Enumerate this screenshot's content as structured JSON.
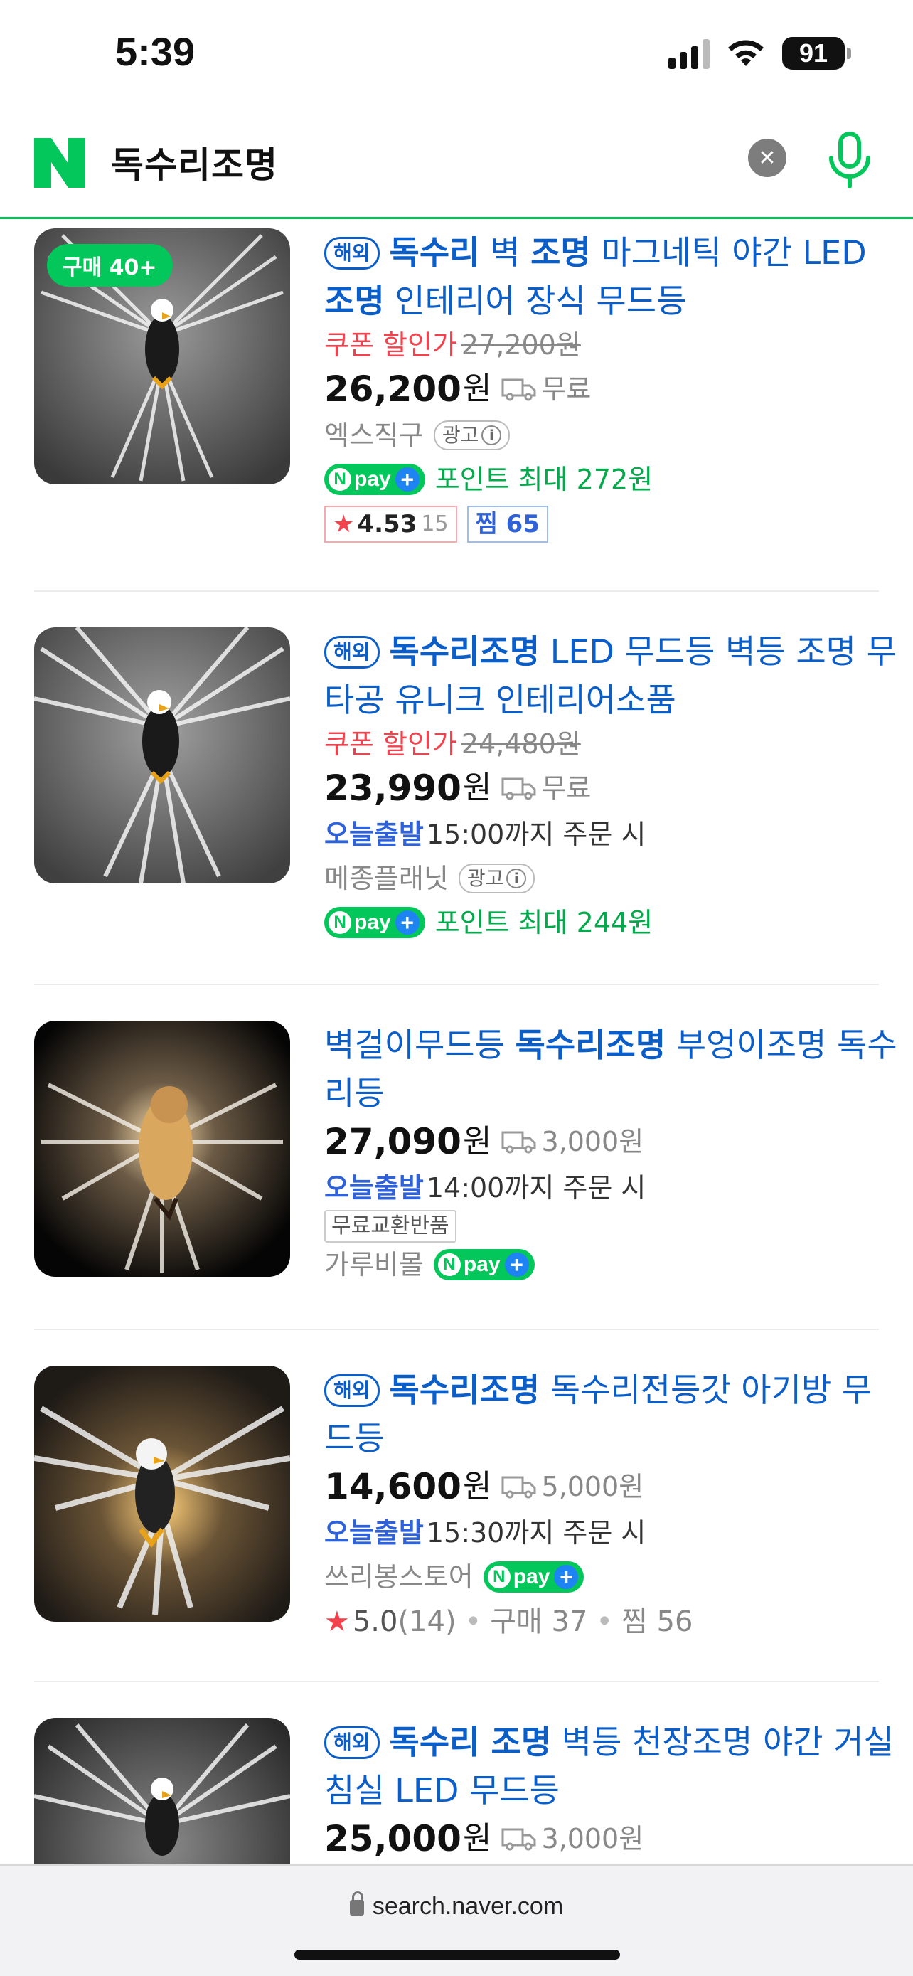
{
  "status_bar": {
    "time": "5:39",
    "battery": "91"
  },
  "search": {
    "query": "독수리조명"
  },
  "products": [
    {
      "buy_badge": "구매 40+",
      "abroad": "해외",
      "title_parts": [
        {
          "t": "독수리",
          "b": true
        },
        {
          "t": " 벽 ",
          "b": false
        },
        {
          "t": "조명",
          "b": true
        },
        {
          "t": " 마그네틱 야간 LED ",
          "b": false
        },
        {
          "t": "조명",
          "b": true
        },
        {
          "t": " 인테리어 장식 무드등",
          "b": false
        }
      ],
      "coupon_label": "쿠폰 할인가",
      "original_price": "27,200원",
      "price": "26,200",
      "won": "원",
      "shipping": "무료",
      "seller": "엑스직구",
      "ad_label": "광고",
      "npay_text": "pay",
      "points": "포인트 최대 272원",
      "rating": "4.53",
      "rating_count": "15",
      "zzim": "찜 65"
    },
    {
      "abroad": "해외",
      "title_parts": [
        {
          "t": "독수리조명",
          "b": true
        },
        {
          "t": " LED 무드등 벽등 조명 무타공 유니크 인테리어소품",
          "b": false
        }
      ],
      "coupon_label": "쿠폰 할인가",
      "original_price": "24,480원",
      "price": "23,990",
      "won": "원",
      "shipping": "무료",
      "today_label": "오늘출발",
      "today_desc": "15:00까지 주문 시",
      "seller": "메종플래닛",
      "ad_label": "광고",
      "npay_text": "pay",
      "points": "포인트 최대 244원"
    },
    {
      "title_parts": [
        {
          "t": "벽걸이무드등 ",
          "b": false
        },
        {
          "t": "독수리조명",
          "b": true
        },
        {
          "t": " 부엉이조명 독수리등",
          "b": false
        }
      ],
      "price": "27,090",
      "won": "원",
      "shipping": "3,000원",
      "today_label": "오늘출발",
      "today_desc": "14:00까지 주문 시",
      "exchange": "무료교환반품",
      "seller": "가루비몰",
      "npay_text": "pay"
    },
    {
      "abroad": "해외",
      "title_parts": [
        {
          "t": "독수리조명",
          "b": true
        },
        {
          "t": " 독수리전등갓 아기방 무드등",
          "b": false
        }
      ],
      "price": "14,600",
      "won": "원",
      "shipping": "5,000원",
      "today_label": "오늘출발",
      "today_desc": "15:30까지 주문 시",
      "seller": "쓰리봉스토어",
      "npay_text": "pay",
      "rating": "5.0",
      "rating_count": "(14)",
      "purchases": "구매 37",
      "zzim": "찜 56"
    },
    {
      "abroad": "해외",
      "title_parts": [
        {
          "t": "독수리 조명",
          "b": true
        },
        {
          "t": " 벽등 천장조명 야간 거실 침실 LED 무드등",
          "b": false
        }
      ],
      "price": "25,000",
      "won": "원",
      "shipping": "3,000원"
    }
  ],
  "url_bar": {
    "url": "search.naver.com"
  },
  "colors": {
    "naver_green": "#03c75a",
    "link_blue": "#0b5ec7",
    "coupon_red": "#f2424e",
    "today_blue": "#2f62d8"
  },
  "icons": [
    "signal-icon",
    "wifi-icon",
    "battery-icon",
    "naver-logo",
    "clear-icon",
    "mic-icon",
    "truck-icon",
    "info-icon",
    "star-icon",
    "lock-icon",
    "npay-logo"
  ]
}
